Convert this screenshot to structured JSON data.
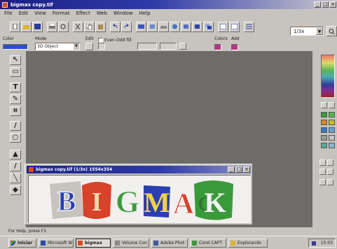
{
  "app": {
    "title": "bigmax copy.tif"
  },
  "window_buttons": [
    "_",
    "□",
    "×"
  ],
  "menu": [
    "File",
    "Edit",
    "View",
    "Format",
    "Effect",
    "Web",
    "Window",
    "Help"
  ],
  "toolbar": {
    "zoom_value": "1/3x"
  },
  "options_bar": {
    "color_label": "Color",
    "mode_label": "Mode",
    "mode_value": "3D Object",
    "edit_label": "Edit",
    "checkbox_label": "Even-Odd fill",
    "colors_label": "Colors",
    "add_label": "Add"
  },
  "colors": {
    "title_bar": "#1c1f86",
    "workspace": "#6e6c69",
    "fill_swatch": "#2c50c4",
    "palette_swatch": "#b3358a"
  },
  "image_window": {
    "title": "bigmax copy.tif (1/3x) 1554x354",
    "artwork_text": [
      "B",
      "I",
      "G",
      "M",
      "A",
      "C",
      "K"
    ]
  },
  "status": {
    "text": "For Help, press F1"
  },
  "taskbar": {
    "start": "Iniciar",
    "items": [
      "Microsoft W",
      "bigmax",
      "Volume Con",
      "Adobe Phot",
      "Corel CAPT",
      "Explorando"
    ],
    "clock": "15:03"
  },
  "icons": {
    "app": "app-logo-icon",
    "tools": [
      "pointer-icon",
      "shape-icon",
      "text-icon",
      "node-edit-icon",
      "crop-icon",
      "eyedropper-icon",
      "zoom-icon",
      "fill-icon",
      "brush-icon",
      "line-icon",
      "eraser-icon"
    ]
  }
}
